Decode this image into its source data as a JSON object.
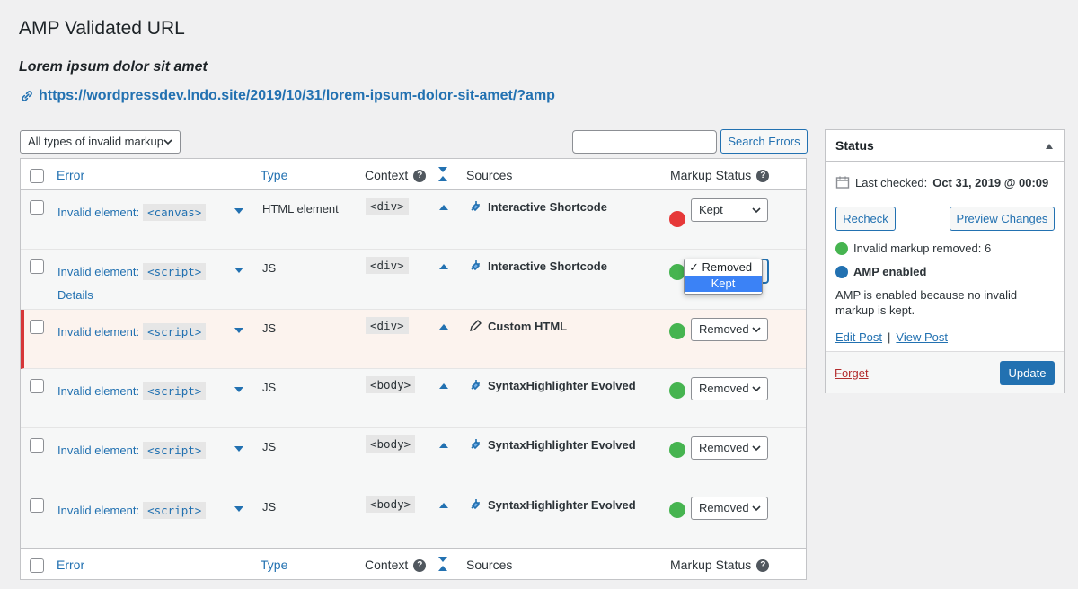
{
  "page": {
    "title": "AMP Validated URL",
    "post_title": "Lorem ipsum dolor sit amet",
    "url": "https://wordpressdev.lndo.site/2019/10/31/lorem-ipsum-dolor-sit-amet/?amp"
  },
  "toolbar": {
    "filter": "All types of invalid markup",
    "search_placeholder": "",
    "search_button": "Search Errors"
  },
  "table": {
    "columns": {
      "error": "Error",
      "type": "Type",
      "context": "Context",
      "sources": "Sources",
      "markup_status": "Markup Status"
    },
    "details_label": "Details",
    "rows": [
      {
        "error": "Invalid element:",
        "tag": "<canvas>",
        "type": "HTML element",
        "context": "<div>",
        "source": "Interactive Shortcode",
        "status": "Kept",
        "bolt": "red"
      },
      {
        "error": "Invalid element:",
        "tag": "<script>",
        "type": "JS",
        "context": "<div>",
        "source": "Interactive Shortcode",
        "status": "Removed",
        "bolt": "green"
      },
      {
        "error": "Invalid element:",
        "tag": "<script>",
        "type": "JS",
        "context": "<div>",
        "source": "Custom HTML",
        "status": "Removed",
        "bolt": "green"
      },
      {
        "error": "Invalid element:",
        "tag": "<script>",
        "type": "JS",
        "context": "<body>",
        "source": "SyntaxHighlighter Evolved",
        "status": "Removed",
        "bolt": "green"
      },
      {
        "error": "Invalid element:",
        "tag": "<script>",
        "type": "JS",
        "context": "<body>",
        "source": "SyntaxHighlighter Evolved",
        "status": "Removed",
        "bolt": "green"
      },
      {
        "error": "Invalid element:",
        "tag": "<script>",
        "type": "JS",
        "context": "<body>",
        "source": "SyntaxHighlighter Evolved",
        "status": "Removed",
        "bolt": "green"
      }
    ],
    "dropdown_options": [
      "✓ Removed",
      "Kept"
    ]
  },
  "status_box": {
    "title": "Status",
    "last_checked_label": "Last checked:",
    "last_checked_value": "Oct 31, 2019 @ 00:09",
    "recheck": "Recheck",
    "preview": "Preview Changes",
    "removed_text": "Invalid markup removed: 6",
    "amp_enabled": "AMP enabled",
    "amp_reason": "AMP is enabled because no invalid markup is kept.",
    "edit_post": "Edit Post",
    "sep": "|",
    "view_post": "View Post",
    "forget": "Forget",
    "update": "Update"
  },
  "colors": {
    "accent": "#2271b1",
    "green": "#46b450",
    "red": "#e63838",
    "highlight_bg": "#fcf3ee"
  }
}
